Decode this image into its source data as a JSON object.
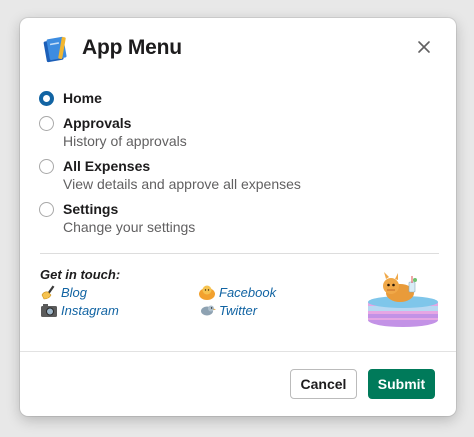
{
  "modal": {
    "title": "App Menu",
    "app_icon": "notebook-icon",
    "close_icon": "close-icon"
  },
  "options": [
    {
      "label": "Home",
      "description": "",
      "selected": true
    },
    {
      "label": "Approvals",
      "description": "History of approvals",
      "selected": false
    },
    {
      "label": "All Expenses",
      "description": "View details and approve all expenses",
      "selected": false
    },
    {
      "label": "Settings",
      "description": "Change your settings",
      "selected": false
    }
  ],
  "contact": {
    "heading": "Get in touch:",
    "links": [
      {
        "label": "Blog",
        "icon": "writing-hand-icon"
      },
      {
        "label": "Facebook",
        "icon": "person-icon"
      },
      {
        "label": "Instagram",
        "icon": "camera-icon"
      },
      {
        "label": "Twitter",
        "icon": "bird-icon"
      }
    ],
    "mascot": "pool-mascot-image"
  },
  "footer": {
    "cancel_label": "Cancel",
    "submit_label": "Submit"
  },
  "colors": {
    "accent": "#1264a3",
    "submit": "#007a5a",
    "muted_text": "#616061"
  }
}
